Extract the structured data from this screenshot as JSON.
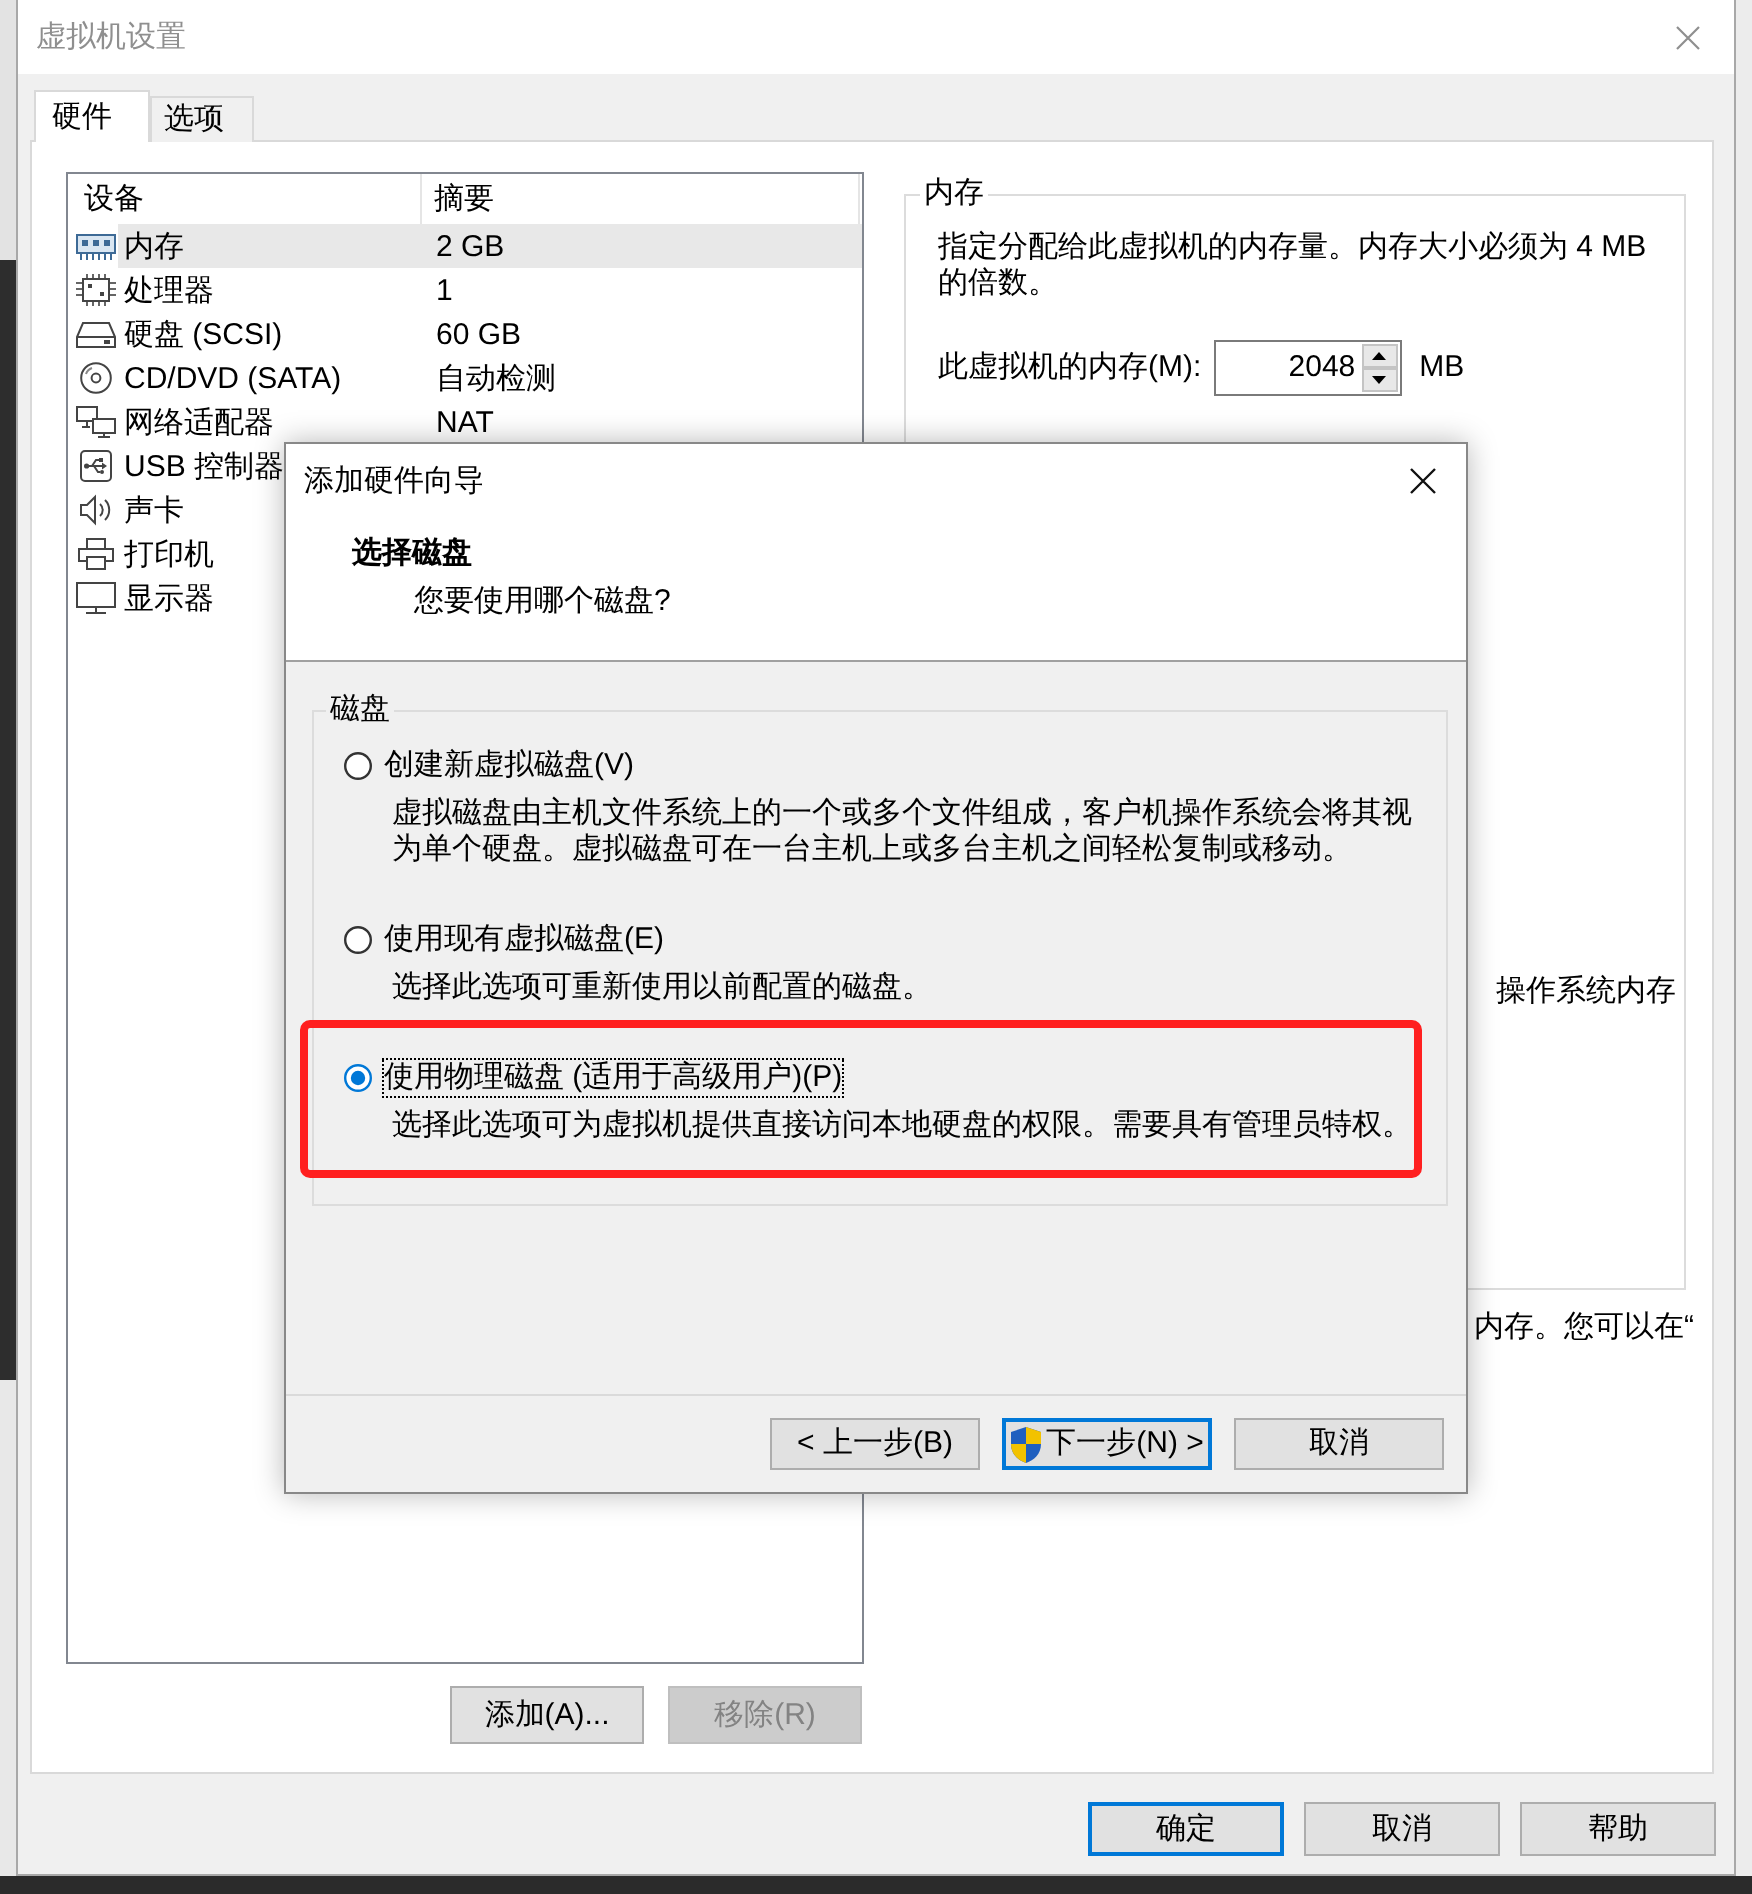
{
  "window": {
    "title": "虚拟机设置",
    "active": false
  },
  "tabs": [
    {
      "label": "硬件",
      "selected": true
    },
    {
      "label": "选项",
      "selected": false
    }
  ],
  "device_list": {
    "columns": [
      "设备",
      "摘要"
    ],
    "devices": [
      {
        "kind": "memory",
        "name": "内存",
        "summary": "2 GB",
        "selected": true
      },
      {
        "kind": "processor",
        "name": "处理器",
        "summary": "1",
        "selected": false
      },
      {
        "kind": "disk",
        "name": "硬盘 (SCSI)",
        "summary": "60 GB",
        "selected": false
      },
      {
        "kind": "cd",
        "name": "CD/DVD (SATA)",
        "summary": "自动检测",
        "selected": false
      },
      {
        "kind": "network",
        "name": "网络适配器",
        "summary": "NAT",
        "selected": false
      },
      {
        "kind": "usb",
        "name": "USB 控制器",
        "selected": false
      },
      {
        "kind": "sound",
        "name": "声卡",
        "selected": false
      },
      {
        "kind": "printer",
        "name": "打印机",
        "selected": false
      },
      {
        "kind": "display",
        "name": "显示器",
        "selected": false
      }
    ]
  },
  "list_buttons": [
    {
      "label": "添加(A)...",
      "disabled": false
    },
    {
      "label": "移除(R)",
      "disabled": true
    }
  ],
  "memory_panel": {
    "title": "内存",
    "description": "指定分配给此虚拟机的内存量。内存大小必须为 4 MB 的倍数。",
    "field_label": "此虚拟机的内存(M):",
    "value": "2048",
    "unit": "MB",
    "box_text_fragment": "操作系统内存",
    "note_text_fragment": "内存。您可以在“"
  },
  "footer_buttons": [
    {
      "label": "确定",
      "default": true
    },
    {
      "label": "取消",
      "default": false
    },
    {
      "label": "帮助",
      "default": false
    }
  ],
  "wizard": {
    "title": "添加硬件向导",
    "active": true,
    "heading": "选择磁盘",
    "subheading": "您要使用哪个磁盘?",
    "group_title": "磁盘",
    "options": [
      {
        "label": "创建新虚拟磁盘(V)",
        "description": "虚拟磁盘由主机文件系统上的一个或多个文件组成，客户机操作系统会将其视为单个硬盘。虚拟磁盘可在一台主机上或多台主机之间轻松复制或移动。",
        "selected": false,
        "focused": false,
        "highlighted": false
      },
      {
        "label": "使用现有虚拟磁盘(E)",
        "description": "选择此选项可重新使用以前配置的磁盘。",
        "selected": false,
        "focused": false,
        "highlighted": false
      },
      {
        "label": "使用物理磁盘 (适用于高级用户)(P)",
        "description": "选择此选项可为虚拟机提供直接访问本地硬盘的权限。需要具有管理员特权。",
        "selected": true,
        "focused": true,
        "highlighted": true
      }
    ],
    "buttons": [
      {
        "label": "< 上一步(B)",
        "default": false,
        "shield": false
      },
      {
        "label": "下一步(N) >",
        "default": true,
        "shield": true
      },
      {
        "label": "取消",
        "default": false,
        "shield": false
      }
    ]
  }
}
